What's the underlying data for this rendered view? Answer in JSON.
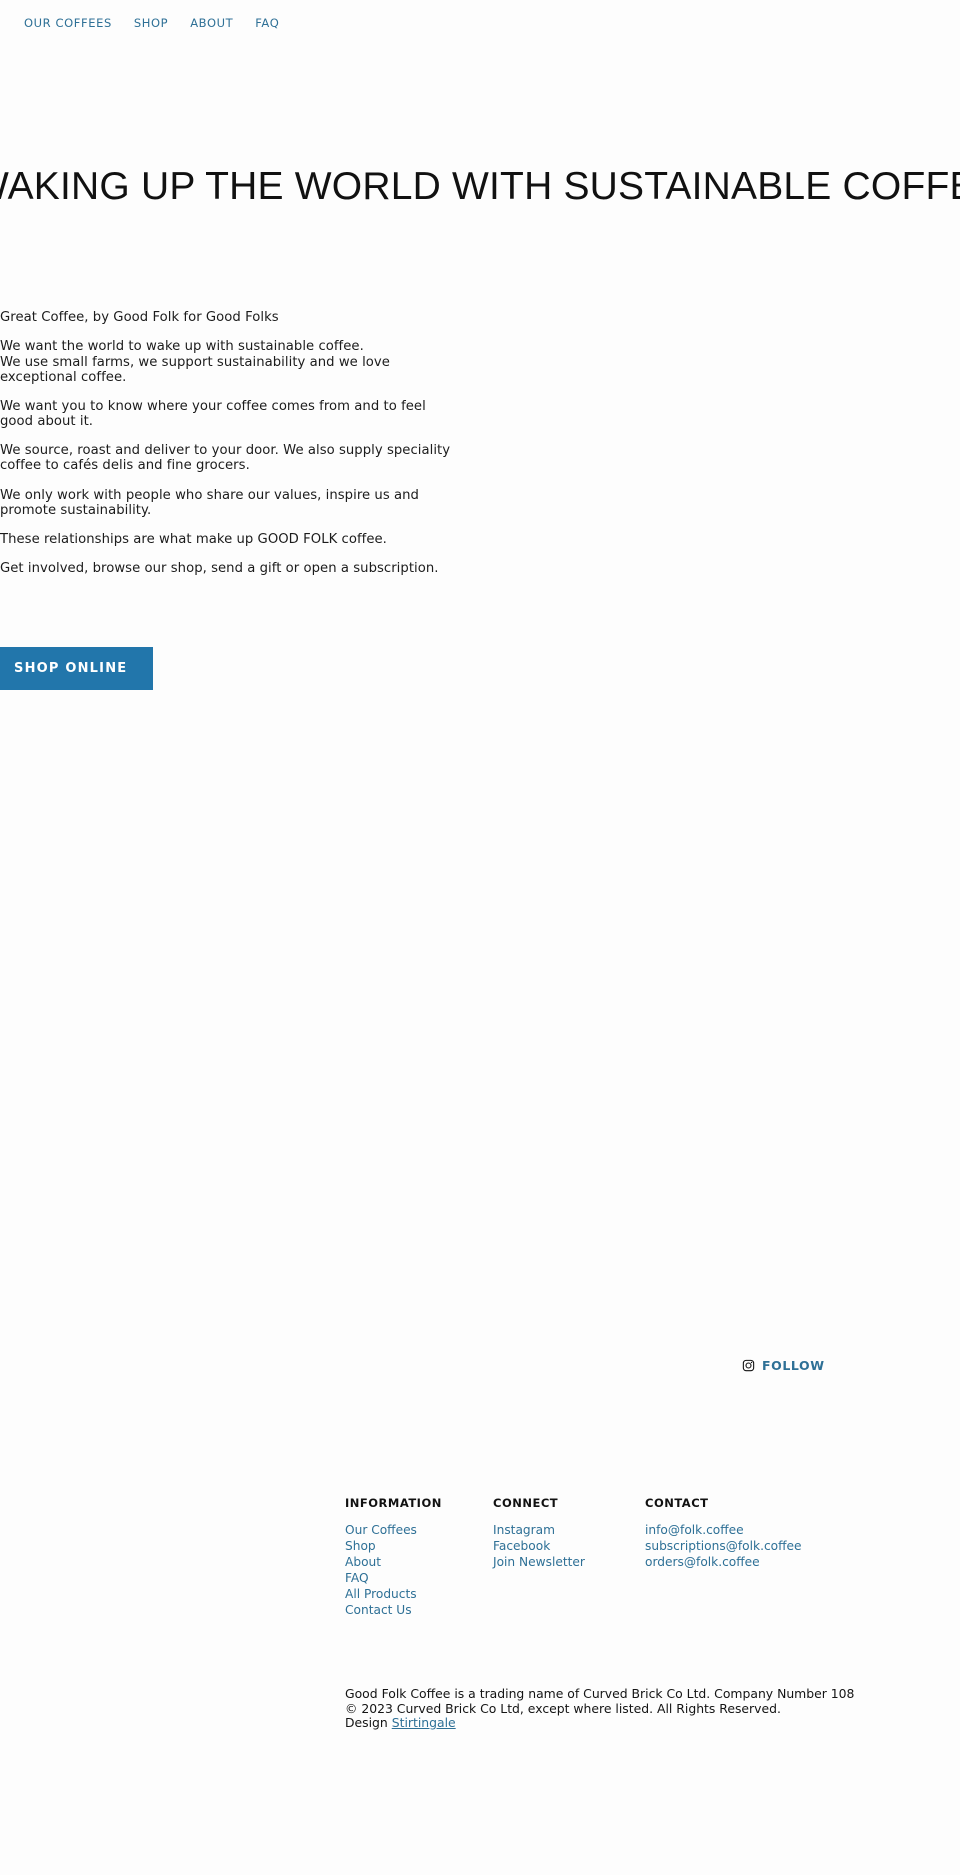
{
  "nav": {
    "items": [
      {
        "label": "OUR COFFEES",
        "name": "nav-our-coffees"
      },
      {
        "label": "SHOP",
        "name": "nav-shop"
      },
      {
        "label": "ABOUT",
        "name": "nav-about"
      },
      {
        "label": "FAQ",
        "name": "nav-faq"
      }
    ]
  },
  "hero": {
    "heading": "WAKING UP THE WORLD WITH SUSTAINABLE COFFEE"
  },
  "copy": {
    "p1": "Great Coffee, by Good Folk for Good Folks",
    "p2_line1": "We want the world to wake up with sustainable coffee.",
    "p2_line2": "We use small farms, we support sustainability and we love exceptional coffee.",
    "p3": "We want you to know where your coffee comes from and to feel good about it.",
    "p4": "We source, roast and deliver to your door. We also supply speciality coffee to cafés delis and fine grocers.",
    "p5": "We only work with people who share our values, inspire us and promote sustainability.",
    "p6": "These relationships are what make up GOOD FOLK coffee.",
    "p7": "Get involved, browse our shop, send a gift or open a subscription."
  },
  "cta": {
    "label": "SHOP ONLINE",
    "color": "#2276ab"
  },
  "social": {
    "icon": "instagram-icon",
    "label": "FOLLOW"
  },
  "footer": {
    "information": {
      "title": "INFORMATION",
      "links": [
        "Our Coffees",
        "Shop",
        "About",
        "FAQ",
        "All Products",
        "Contact Us"
      ]
    },
    "connect": {
      "title": "CONNECT",
      "links": [
        "Instagram",
        "Facebook",
        "Join Newsletter"
      ]
    },
    "contact": {
      "title": "CONTACT",
      "links": [
        "info@folk.coffee",
        "subscriptions@folk.coffee",
        "orders@folk.coffee"
      ]
    },
    "legal": {
      "line1": "Good Folk Coffee is a trading name of Curved Brick Co Ltd. Company Number 108",
      "line2": "© 2023 Curved Brick Co Ltd, except where listed. All Rights Reserved.",
      "line3_prefix": "Design ",
      "line3_link": "Stirtingale"
    }
  },
  "colors": {
    "link": "#2e7096",
    "accent": "#2276ab",
    "text": "#1a1a1a",
    "background": "#fdfdfd"
  }
}
